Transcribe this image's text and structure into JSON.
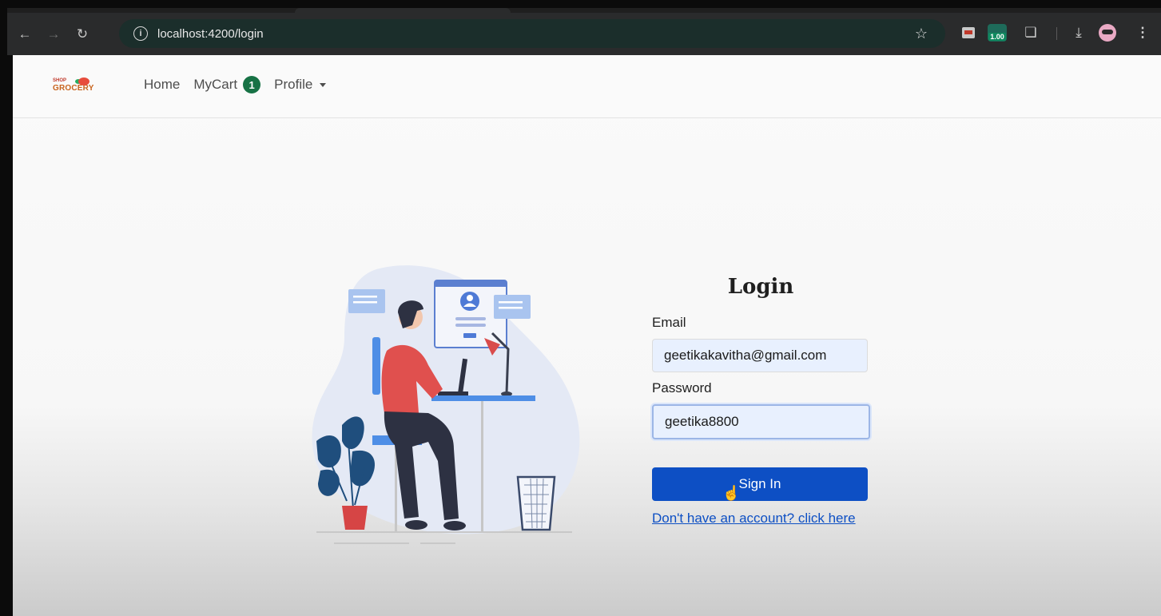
{
  "browser": {
    "url": "localhost:4200/login",
    "zoom_badge": "1.00",
    "icons": {
      "back": "arrow-left-icon",
      "forward": "arrow-right-icon",
      "reload": "reload-icon",
      "site_info": "info-icon",
      "bookmark": "star-icon",
      "extensions": "puzzle-icon",
      "downloads": "download-icon",
      "menu": "kebab-menu-icon"
    }
  },
  "navbar": {
    "logo_top": "SHOP",
    "logo_word": "GROCERY",
    "home_label": "Home",
    "cart_label": "MyCart",
    "cart_count": "1",
    "profile_label": "Profile"
  },
  "login": {
    "title": "Login",
    "email_label": "Email",
    "email_value": "geetikakavitha@gmail.com",
    "password_label": "Password",
    "password_value": "geetika8800",
    "signin_label": "Sign In",
    "register_link": "Don't have an account? click here"
  },
  "colors": {
    "primary": "#0d4fc4",
    "badge": "#177245",
    "autofill": "#e8f0fe"
  }
}
